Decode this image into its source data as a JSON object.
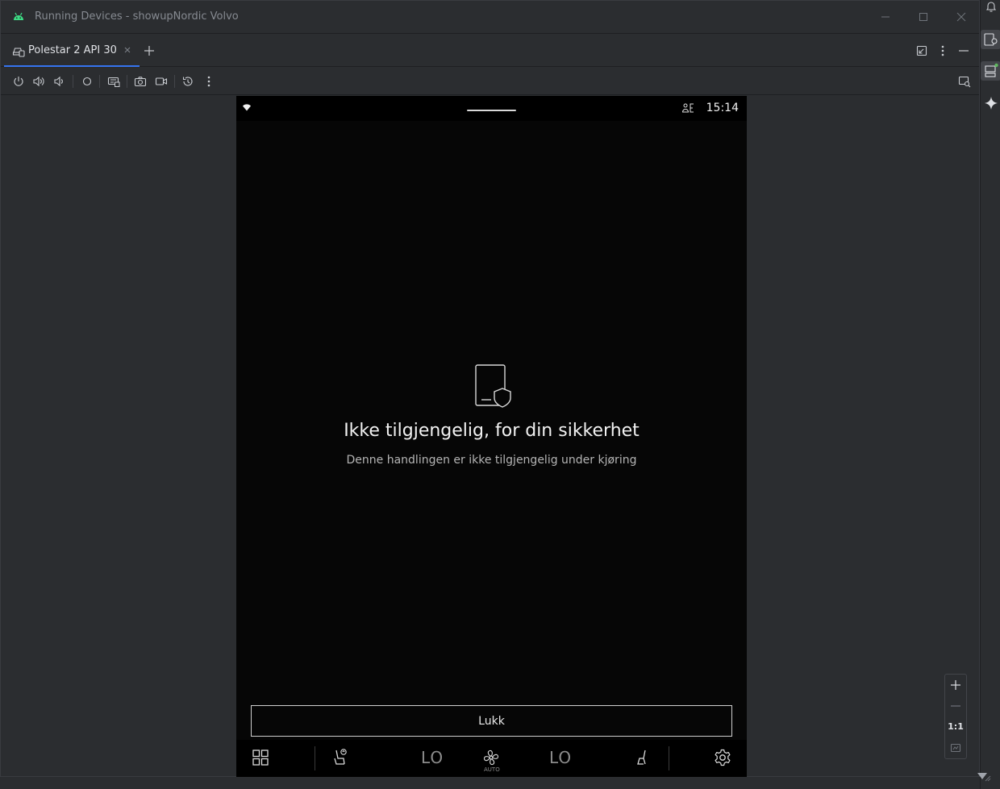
{
  "window": {
    "title": "Running Devices - showupNordic Volvo"
  },
  "tabs": [
    {
      "label": "Polestar 2 API 30"
    }
  ],
  "device": {
    "status_time": "15:14",
    "message_title": "Ikke tilgjengelig, for din sikkerhet",
    "message_subtitle": "Denne handlingen er ikke tilgjengelig under kjøring",
    "close_label": "Lukk",
    "climate": {
      "left_temp": "LO",
      "right_temp": "LO",
      "fan_mode": "AUTO"
    }
  },
  "zoom": {
    "actual_size_label": "1:1"
  },
  "colors": {
    "accent": "#3574f0",
    "android_green": "#3ddc84",
    "notification_dot": "#5fb85f"
  }
}
